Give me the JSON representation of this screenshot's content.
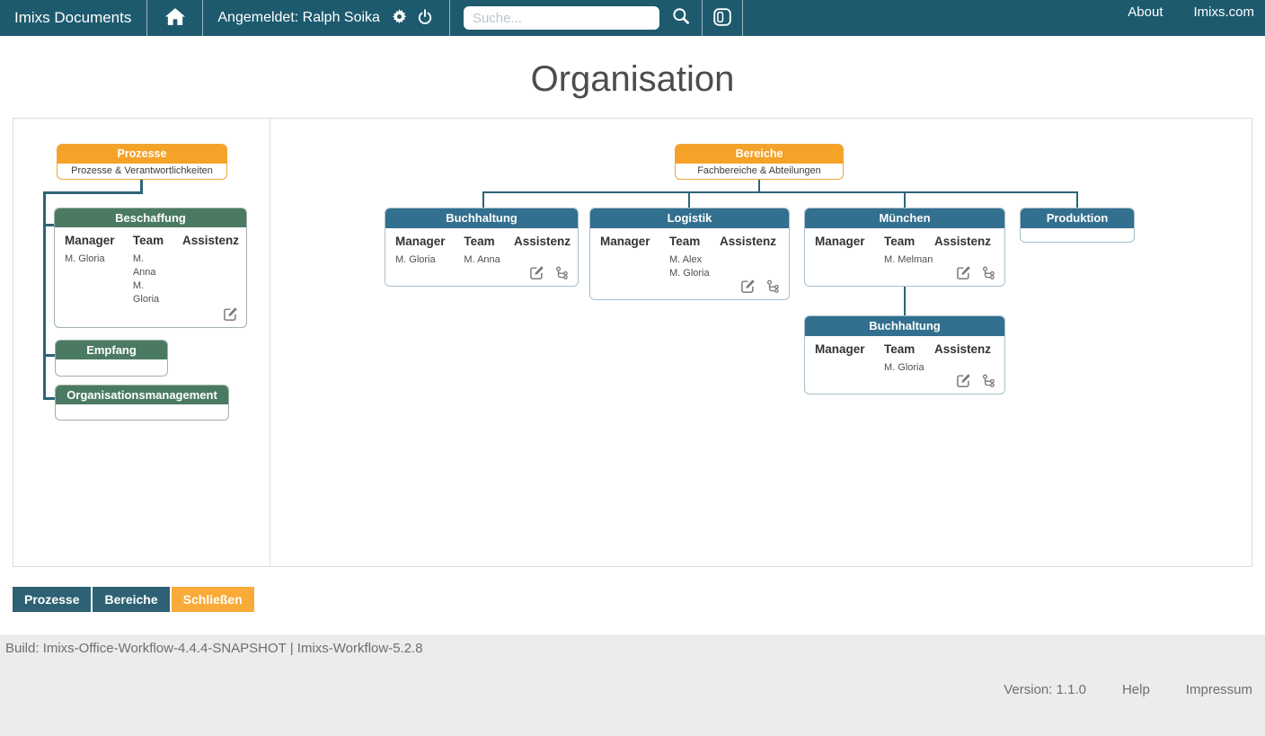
{
  "navbar": {
    "brand": "Imixs Documents",
    "user": "Angemeldet: Ralph Soika",
    "search": {
      "placeholder": "Suche..."
    },
    "links": [
      {
        "label": "About"
      },
      {
        "label": "Imixs.com"
      }
    ]
  },
  "page": {
    "title": "Organisation"
  },
  "org": {
    "columns": [
      "Manager",
      "Team",
      "Assistenz"
    ],
    "prozesse": {
      "title": "Prozesse",
      "subtitle": "Prozesse & Verantwortlichkeiten"
    },
    "bereiche": {
      "title": "Bereiche",
      "subtitle": "Fachbereiche & Abteilungen"
    },
    "nodes": {
      "beschaffung": {
        "title": "Beschaffung",
        "manager": "M. Gloria",
        "team": [
          "M. Anna",
          "M. Gloria"
        ],
        "team_display": [
          "M.",
          "Anna",
          "M.",
          "Gloria"
        ],
        "assistenz": ""
      },
      "empfang": {
        "title": "Empfang"
      },
      "orgmgmt": {
        "title": "Organisationsmanagement"
      },
      "buchhaltung": {
        "title": "Buchhaltung",
        "manager": "M. Gloria",
        "team_display": [
          "M. Anna"
        ],
        "assistenz": ""
      },
      "logistik": {
        "title": "Logistik",
        "manager": "",
        "team_display": [
          "M. Alex",
          "M. Gloria"
        ],
        "assistenz": ""
      },
      "muenchen": {
        "title": "München",
        "manager": "",
        "team_display": [
          "M. Melman"
        ],
        "assistenz": ""
      },
      "produktion": {
        "title": "Produktion"
      },
      "buchhaltung_muenchen": {
        "title": "Buchhaltung",
        "manager": "",
        "team_display": [
          "M. Gloria"
        ],
        "assistenz": ""
      }
    }
  },
  "actions": [
    {
      "label": "Prozesse"
    },
    {
      "label": "Bereiche"
    },
    {
      "label": "Schließen"
    }
  ],
  "footer": {
    "build": "Build: Imixs-Office-Workflow-4.4.4-SNAPSHOT | Imixs-Workflow-5.2.8",
    "version": "Version: 1.1.0",
    "links": [
      {
        "label": "Help"
      },
      {
        "label": "Impressum"
      }
    ]
  },
  "colors": {
    "navbar": "#1d5a6e",
    "accent_orange": "#f5a228",
    "node_green": "#4b7a63",
    "node_blue": "#336f8e",
    "connector": "#2d6478",
    "button_teal": "#2d6173"
  }
}
